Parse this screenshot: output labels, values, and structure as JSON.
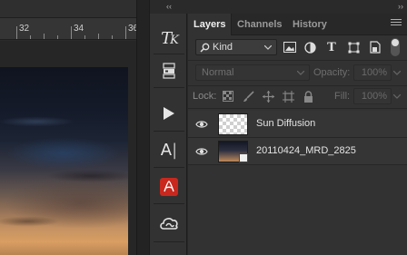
{
  "ruler": {
    "mark_a": "32",
    "mark_b": "34",
    "mark_c": "36"
  },
  "tools": [
    {
      "name": "type-tool-icon",
      "glyph": "TK"
    },
    {
      "name": "3d-tool-icon"
    },
    {
      "name": "play-icon"
    },
    {
      "name": "character-panel-icon",
      "glyph": "A|"
    },
    {
      "name": "adobe-reader-icon"
    },
    {
      "name": "creative-cloud-icon"
    }
  ],
  "layers_panel": {
    "tabs": [
      "Layers",
      "Channels",
      "History"
    ],
    "active_tab": "Layers",
    "filter": {
      "selected": "Kind"
    },
    "blend_mode": "Normal",
    "opacity_label": "Opacity:",
    "opacity_value": "100%",
    "lock_label": "Lock:",
    "fill_label": "Fill:",
    "fill_value": "100%",
    "layers": [
      {
        "name": "Sun Diffusion",
        "visible": true,
        "thumb": "transparent"
      },
      {
        "name": "20110424_MRD_2825",
        "visible": true,
        "thumb": "photo",
        "smart_object": true
      }
    ]
  },
  "colors": {
    "panel_bg": "#323232",
    "tab_bar_bg": "#282828",
    "active_text": "#f0f0f0",
    "reader_red": "#c8281e"
  }
}
